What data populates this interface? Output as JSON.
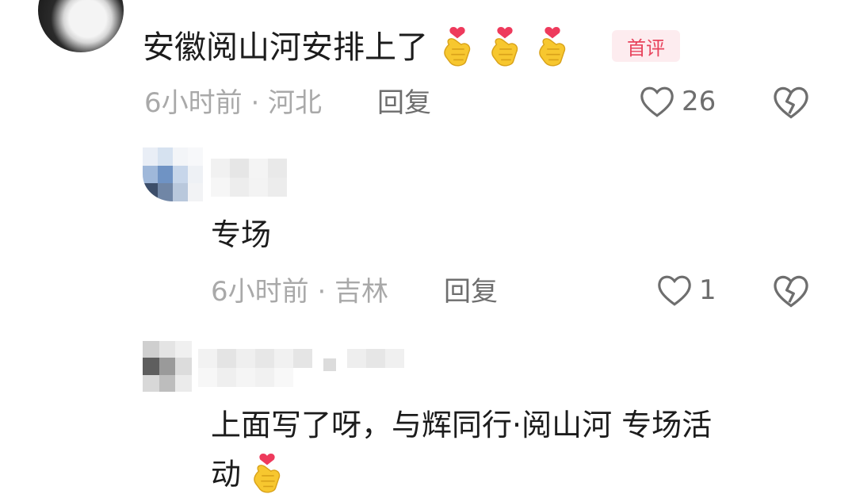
{
  "main_comment": {
    "text": "安徽阅山河安排上了",
    "emoji_count": 3,
    "badge": "首评",
    "meta": "6小时前 · 河北",
    "reply_label": "回复",
    "likes": "26",
    "icons": [
      "heart-outline-icon",
      "broken-heart-icon",
      "finger-heart-emoji"
    ]
  },
  "reply_1": {
    "text": "专场",
    "meta": "6小时前 · 吉林",
    "reply_label": "回复",
    "likes": "1"
  },
  "reply_2": {
    "text_line1": "上面写了呀，与辉同行·阅山河  专场活",
    "text_line2": "动"
  },
  "colors": {
    "text": "#1c1c1c",
    "meta": "#a9a9a9",
    "badge_bg": "#fdecef",
    "badge_text": "#e8455e",
    "emoji_yellow": "#f7c72f",
    "heart_red": "#ee3a5c"
  }
}
